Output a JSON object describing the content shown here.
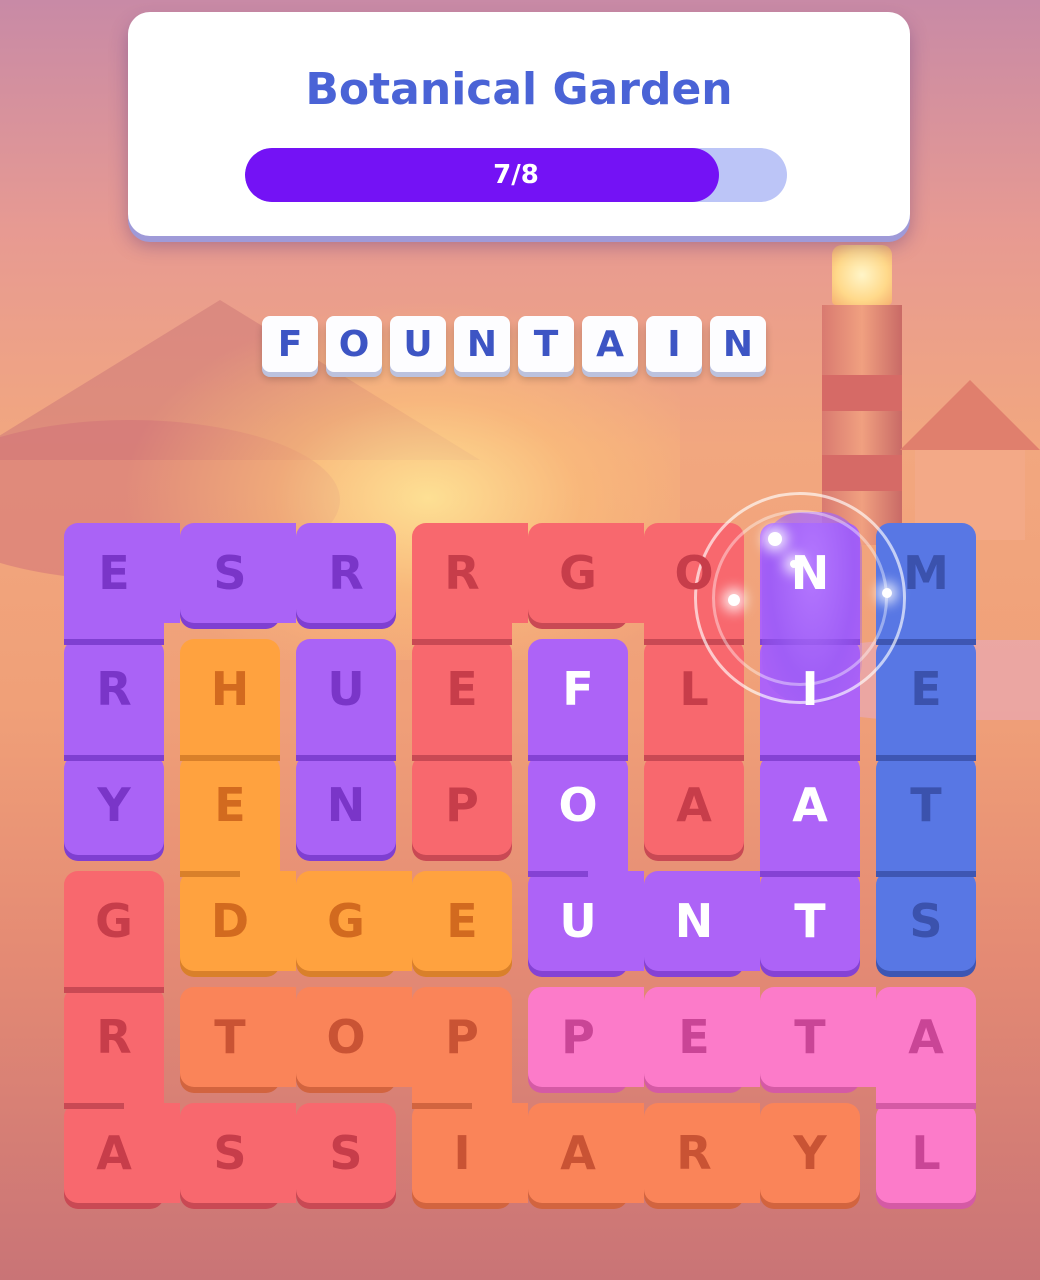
{
  "level": {
    "title": "Botanical Garden",
    "progress_text": "7/8",
    "progress_fraction": 0.875
  },
  "current_word": [
    "F",
    "O",
    "U",
    "N",
    "T",
    "A",
    "I",
    "N"
  ],
  "board": {
    "colors": {
      "purple": {
        "fill": "#aa63f6",
        "shade": "#7f3fd1",
        "letter": "#7a35c8"
      },
      "red": {
        "fill": "#f8686e",
        "shade": "#c94954",
        "letter": "#c73d4a"
      },
      "blue": {
        "fill": "#5877e4",
        "shade": "#3e56b3",
        "letter": "#3b52ad"
      },
      "orange": {
        "fill": "#ffa23f",
        "shade": "#d9802a",
        "letter": "#d26a1f"
      },
      "coral": {
        "fill": "#fa8459",
        "shade": "#d2643f",
        "letter": "#c95334"
      },
      "pink": {
        "fill": "#fc7bc9",
        "shade": "#d55aa5",
        "letter": "#c94596"
      },
      "violet": {
        "fill": "#ad63f7",
        "shade": "#8542d4",
        "letter": "#ffffff"
      }
    },
    "words": [
      {
        "color": "purple",
        "cells": [
          [
            2,
            1
          ],
          [
            1,
            1
          ],
          [
            0,
            1
          ],
          [
            0,
            2
          ],
          [
            0,
            3
          ],
          [
            0,
            4
          ],
          [
            0,
            0
          ],
          [
            1,
            0
          ],
          [
            2,
            0
          ]
        ],
        "path": [
          [
            2,
            0
          ],
          [
            1,
            0
          ],
          [
            0,
            0
          ],
          [
            0,
            1
          ],
          [
            0,
            2
          ],
          [
            0,
            3
          ],
          [
            0,
            4
          ],
          [
            1,
            1
          ],
          [
            2,
            1
          ]
        ]
      },
      {
        "color": "red",
        "cells": [
          [
            0,
            3
          ],
          [
            0,
            4
          ],
          [
            0,
            5
          ],
          [
            0,
            6
          ],
          [
            1,
            3
          ],
          [
            2,
            3
          ],
          [
            1,
            5
          ],
          [
            2,
            5
          ]
        ]
      },
      {
        "color": "blue",
        "cells": [
          [
            0,
            8
          ],
          [
            1,
            8
          ],
          [
            2,
            8
          ],
          [
            3,
            8
          ]
        ]
      },
      {
        "color": "orange",
        "cells": [
          [
            1,
            1
          ],
          [
            2,
            1
          ],
          [
            3,
            1
          ],
          [
            3,
            2
          ],
          [
            3,
            3
          ]
        ]
      },
      {
        "color": "violet",
        "cells": [
          [
            1,
            4
          ],
          [
            2,
            4
          ],
          [
            3,
            4
          ],
          [
            3,
            5
          ],
          [
            3,
            6
          ],
          [
            2,
            6
          ],
          [
            1,
            6
          ],
          [
            0,
            6
          ],
          [
            0,
            7
          ],
          [
            1,
            7
          ],
          [
            2,
            7
          ],
          [
            3,
            7
          ]
        ]
      },
      {
        "color": "red",
        "cells": [
          [
            3,
            0
          ],
          [
            4,
            0
          ],
          [
            5,
            0
          ],
          [
            5,
            1
          ],
          [
            5,
            2
          ]
        ]
      },
      {
        "color": "coral",
        "cells": [
          [
            4,
            1
          ],
          [
            4,
            2
          ],
          [
            4,
            3
          ],
          [
            5,
            3
          ],
          [
            5,
            4
          ],
          [
            5,
            5
          ],
          [
            5,
            6
          ]
        ]
      },
      {
        "color": "pink",
        "cells": [
          [
            4,
            4
          ],
          [
            4,
            5
          ],
          [
            4,
            6
          ],
          [
            4,
            7
          ],
          [
            5,
            7
          ]
        ]
      }
    ],
    "letters": [
      [
        "E",
        "S",
        "R",
        "R",
        "G",
        "O",
        "N",
        "M"
      ],
      [
        "R",
        "H",
        "U",
        "E",
        "F",
        "L",
        "I",
        "E"
      ],
      [
        "Y",
        "E",
        "N",
        "P",
        "O",
        "A",
        "A",
        "T"
      ],
      [
        "G",
        "D",
        "G",
        "E",
        "U",
        "N",
        "T",
        "S"
      ],
      [
        "R",
        "T",
        "O",
        "P",
        "P",
        "E",
        "T",
        "A"
      ],
      [
        "A",
        "S",
        "S",
        "I",
        "A",
        "R",
        "Y",
        "L"
      ]
    ],
    "cell_colors": [
      [
        "purple",
        "purple",
        "purple",
        "red",
        "red",
        "red",
        "violet",
        "blue"
      ],
      [
        "purple",
        "orange",
        "purple",
        "red",
        "violet",
        "red",
        "violet",
        "blue"
      ],
      [
        "purple",
        "orange",
        "purple",
        "red",
        "violet",
        "red",
        "violet",
        "blue"
      ],
      [
        "red",
        "orange",
        "orange",
        "orange",
        "violet",
        "violet",
        "violet",
        "blue"
      ],
      [
        "red",
        "coral",
        "coral",
        "coral",
        "pink",
        "pink",
        "pink",
        "pink"
      ],
      [
        "red",
        "red",
        "red",
        "coral",
        "coral",
        "coral",
        "coral",
        "pink"
      ]
    ]
  }
}
